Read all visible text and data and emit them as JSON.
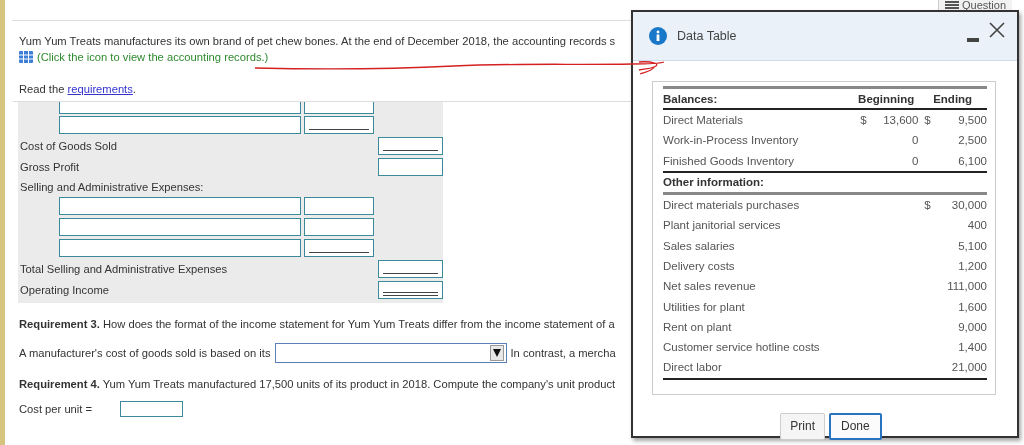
{
  "question_tab": {
    "label": "Question"
  },
  "intro": {
    "text": "Yum Yum Treats manufactures its own brand of pet chew bones. At the end of December 2018, the accounting records s",
    "records_link": "(Click the icon to view the accounting records.)",
    "read_prefix": "Read the",
    "requirements_link": "requirements",
    "read_suffix": "."
  },
  "form_rows": [
    {
      "kind": "pair",
      "single_rule": false,
      "cut": true
    },
    {
      "kind": "pair",
      "single_rule": true,
      "cut": false
    },
    {
      "kind": "total",
      "label": "Cost of Goods Sold",
      "single_rule": true,
      "double_rule": false
    },
    {
      "kind": "total",
      "label": "Gross Profit",
      "single_rule": false,
      "double_rule": false
    },
    {
      "kind": "heading",
      "label": "Selling and Administrative Expenses:"
    },
    {
      "kind": "pair",
      "single_rule": false,
      "cut": false
    },
    {
      "kind": "pair",
      "single_rule": false,
      "cut": false
    },
    {
      "kind": "pair",
      "single_rule": true,
      "cut": false
    },
    {
      "kind": "total",
      "label": "Total Selling and Administrative Expenses",
      "single_rule": true,
      "double_rule": false
    },
    {
      "kind": "total",
      "label": "Operating Income",
      "single_rule": false,
      "double_rule": true
    }
  ],
  "requirement_3": {
    "text": "**Requirement 3.** How does the format of the income statement for Yum Yum Treats differ from the income statement of a",
    "answer_prefix": "A manufacturer's cost of goods sold is based on its",
    "answer_suffix": "In contrast, a mercha"
  },
  "requirement_4": {
    "text": "**Requirement 4.** Yum Yum Treats manufactured 17,500 units of its product in 2018. Compute the company's unit product",
    "answer_label": "Cost per unit ="
  },
  "dialog": {
    "title": "Data Table",
    "columns": [
      "Balances:",
      "Beginning",
      "Ending"
    ],
    "balances": [
      {
        "label": "Direct Materials",
        "begin_sign": "$",
        "begin": "13,600",
        "end_sign": "$",
        "end": "9,500"
      },
      {
        "label": "Work-in-Process Inventory",
        "begin": "0",
        "end": "2,500"
      },
      {
        "label": "Finished Goods Inventory",
        "begin": "0",
        "end": "6,100"
      }
    ],
    "other_heading": "Other information:",
    "other": [
      {
        "label": "Direct materials purchases",
        "sign": "$",
        "value": "30,000"
      },
      {
        "label": "Plant janitorial services",
        "value": "400"
      },
      {
        "label": "Sales salaries",
        "value": "5,100"
      },
      {
        "label": "Delivery costs",
        "value": "1,200"
      },
      {
        "label": "Net sales revenue",
        "value": "111,000"
      },
      {
        "label": "Utilities for plant",
        "value": "1,600"
      },
      {
        "label": "Rent on plant",
        "value": "9,000"
      },
      {
        "label": "Customer service hotline costs",
        "value": "1,400"
      },
      {
        "label": "Direct labor",
        "value": "21,000"
      }
    ],
    "buttons": [
      {
        "label": "Print",
        "focused": false
      },
      {
        "label": "Done",
        "focused": true
      }
    ]
  }
}
